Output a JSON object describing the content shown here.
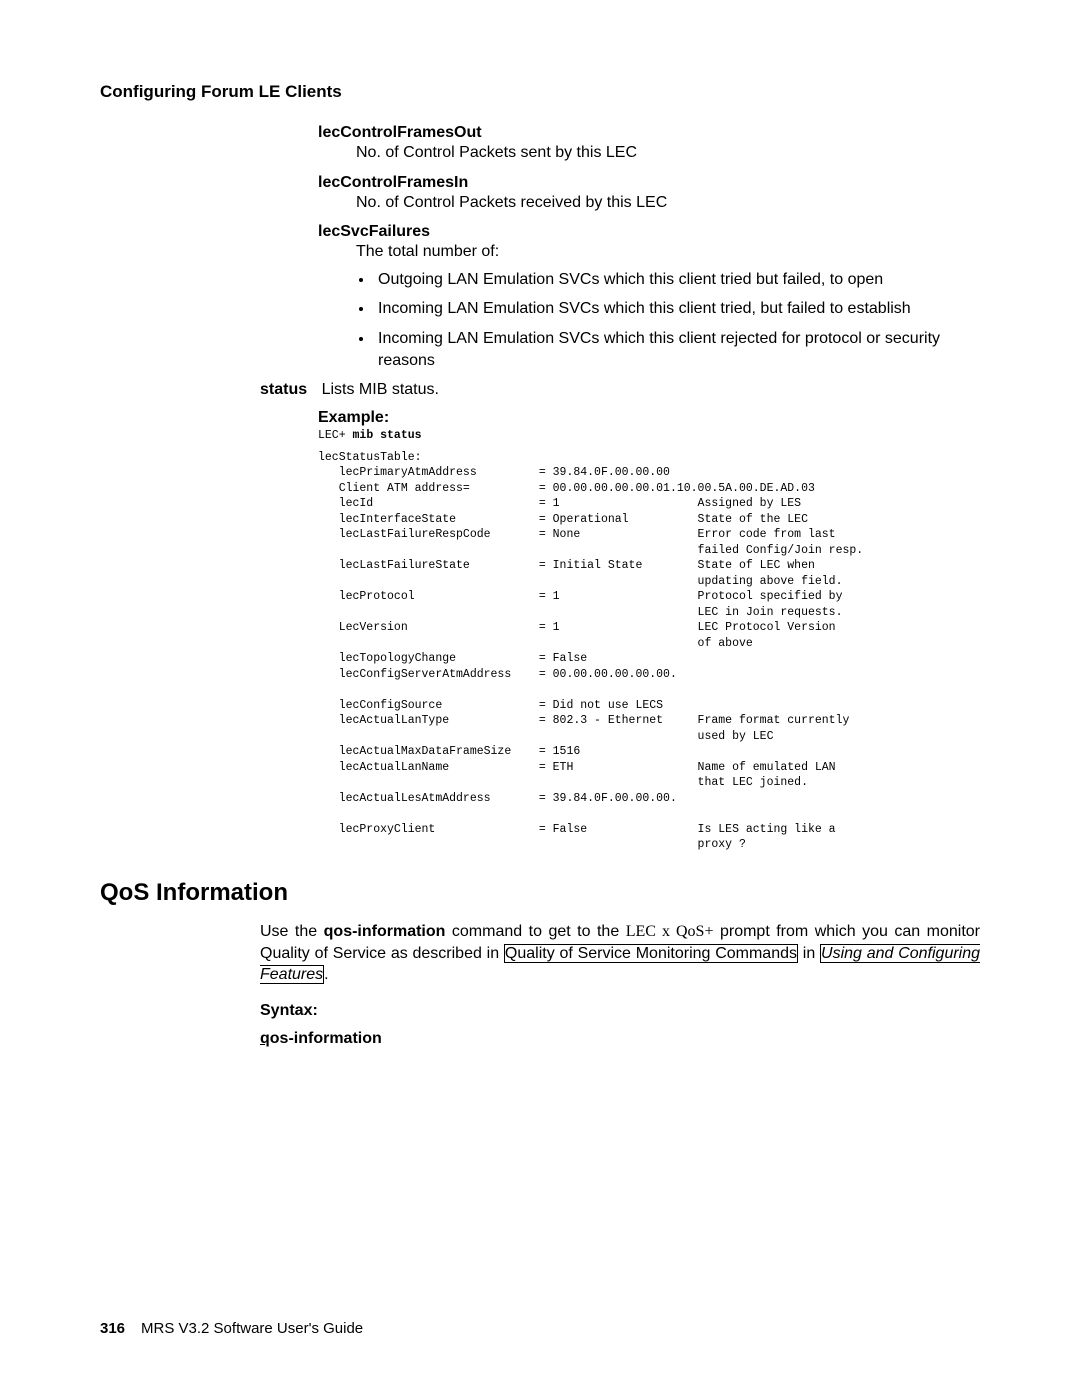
{
  "header": "Configuring Forum LE Clients",
  "params": {
    "out": {
      "title": "lecControlFramesOut",
      "desc": "No. of Control Packets sent by this LEC"
    },
    "in": {
      "title": "lecControlFramesIn",
      "desc": "No. of Control Packets received by this LEC"
    },
    "svc": {
      "title": "lecSvcFailures",
      "intro": "The total number of:",
      "bullets": [
        "Outgoing LAN Emulation SVCs which this client tried but failed, to open",
        "Incoming LAN Emulation SVCs which this client tried, but failed to establish",
        "Incoming LAN Emulation SVCs which this client rejected for protocol or security reasons"
      ]
    }
  },
  "status": {
    "label": "status",
    "text": "Lists MIB status."
  },
  "example": {
    "label": "Example:",
    "prompt": "LEC+ ",
    "cmd": "mib status",
    "body": "lecStatusTable:\n   lecPrimaryAtmAddress         = 39.84.0F.00.00.00\n   Client ATM address=          = 00.00.00.00.00.01.10.00.5A.00.DE.AD.03\n   lecId                        = 1                    Assigned by LES\n   lecInterfaceState            = Operational          State of the LEC\n   lecLastFailureRespCode       = None                 Error code from last\n                                                       failed Config/Join resp.\n   lecLastFailureState          = Initial State        State of LEC when\n                                                       updating above field.\n   lecProtocol                  = 1                    Protocol specified by\n                                                       LEC in Join requests.\n   LecVersion                   = 1                    LEC Protocol Version\n                                                       of above\n   lecTopologyChange            = False\n   lecConfigServerAtmAddress    = 00.00.00.00.00.00.\n\n   lecConfigSource              = Did not use LECS\n   lecActualLanType             = 802.3 - Ethernet     Frame format currently\n                                                       used by LEC\n   lecActualMaxDataFrameSize    = 1516\n   lecActualLanName             = ETH                  Name of emulated LAN\n                                                       that LEC joined.\n   lecActualLesAtmAddress       = 39.84.0F.00.00.00.\n\n   lecProxyClient               = False                Is LES acting like a\n                                                       proxy ?"
  },
  "qos": {
    "heading": "QoS Information",
    "para_pre": "Use the ",
    "cmd_bold": "qos-information",
    "para_mid1": " command to get to the ",
    "prompt_serif": "LEC x QoS+",
    "para_mid2": " prompt from which you can monitor Quality of Service as described in ",
    "link1": "Quality of Service Monitoring Commands",
    "para_mid3": " in ",
    "link2": "Using and Configuring Features",
    "para_end": ".",
    "syntax": "Syntax:",
    "cmd_first": "q",
    "cmd_rest": "os-information"
  },
  "footer": {
    "page": "316",
    "title": "MRS V3.2 Software User's Guide"
  }
}
